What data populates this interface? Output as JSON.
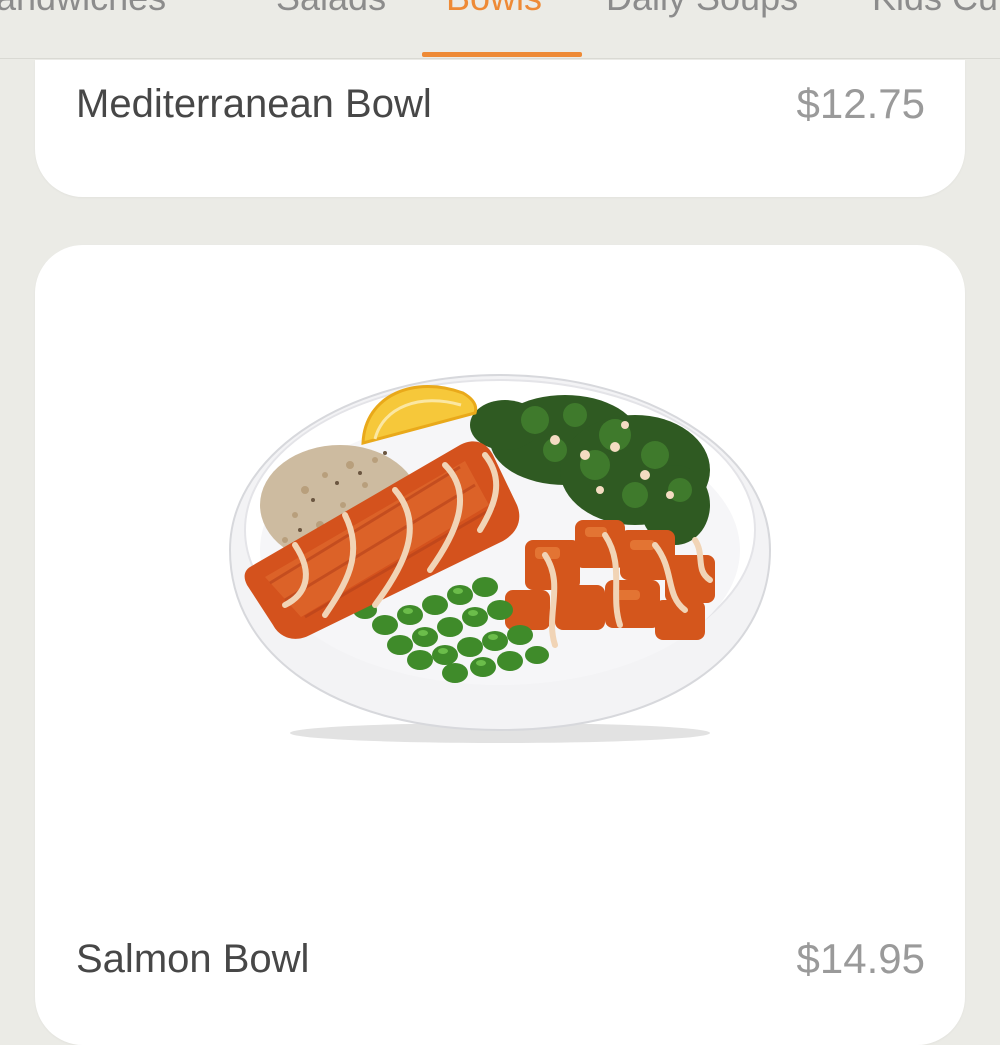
{
  "tabs": [
    {
      "label": "Sandwiches",
      "active": false
    },
    {
      "label": "Salads",
      "active": false
    },
    {
      "label": "Bowls",
      "active": true
    },
    {
      "label": "Daily Soups",
      "active": false
    },
    {
      "label": "Kids Cu",
      "active": false
    }
  ],
  "colors": {
    "accent": "#ee8a36",
    "background": "#ebebe6",
    "card": "#ffffff",
    "name_text": "#474747",
    "price_text": "#9a9a9a"
  },
  "menu_items": [
    {
      "name": "Mediterranean Bowl",
      "price": "$12.75"
    },
    {
      "name": "Salmon Bowl",
      "price": "$14.95",
      "image_icon": "salmon-bowl-photo"
    }
  ]
}
